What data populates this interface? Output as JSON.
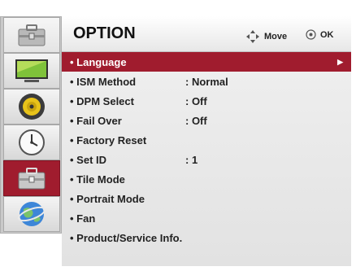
{
  "header": {
    "title": "OPTION",
    "move_label": "Move",
    "ok_label": "OK"
  },
  "sidebar": {
    "items": [
      {
        "icon": "option-toolbox-icon"
      },
      {
        "icon": "picture-monitor-icon"
      },
      {
        "icon": "audio-speaker-icon"
      },
      {
        "icon": "clock-time-icon"
      },
      {
        "icon": "option-toolbox-icon",
        "selected": true
      },
      {
        "icon": "network-globe-icon"
      }
    ]
  },
  "menu": {
    "items": [
      {
        "label": "• Language",
        "value": "",
        "selected": true
      },
      {
        "label": "• ISM Method",
        "value": ": Normal"
      },
      {
        "label": "• DPM Select",
        "value": ": Off"
      },
      {
        "label": "• Fail Over",
        "value": ": Off"
      },
      {
        "label": "• Factory Reset",
        "value": ""
      },
      {
        "label": "• Set ID",
        "value": ": 1"
      },
      {
        "label": "• Tile Mode",
        "value": ""
      },
      {
        "label": "• Portrait Mode",
        "value": ""
      },
      {
        "label": "• Fan",
        "value": ""
      },
      {
        "label": "• Product/Service Info.",
        "value": ""
      }
    ],
    "arrow": "▶"
  },
  "colors": {
    "accent": "#a01c2e",
    "menu_bg": "#e8e8e8",
    "sidebar_bg": "#c9c9c9"
  }
}
